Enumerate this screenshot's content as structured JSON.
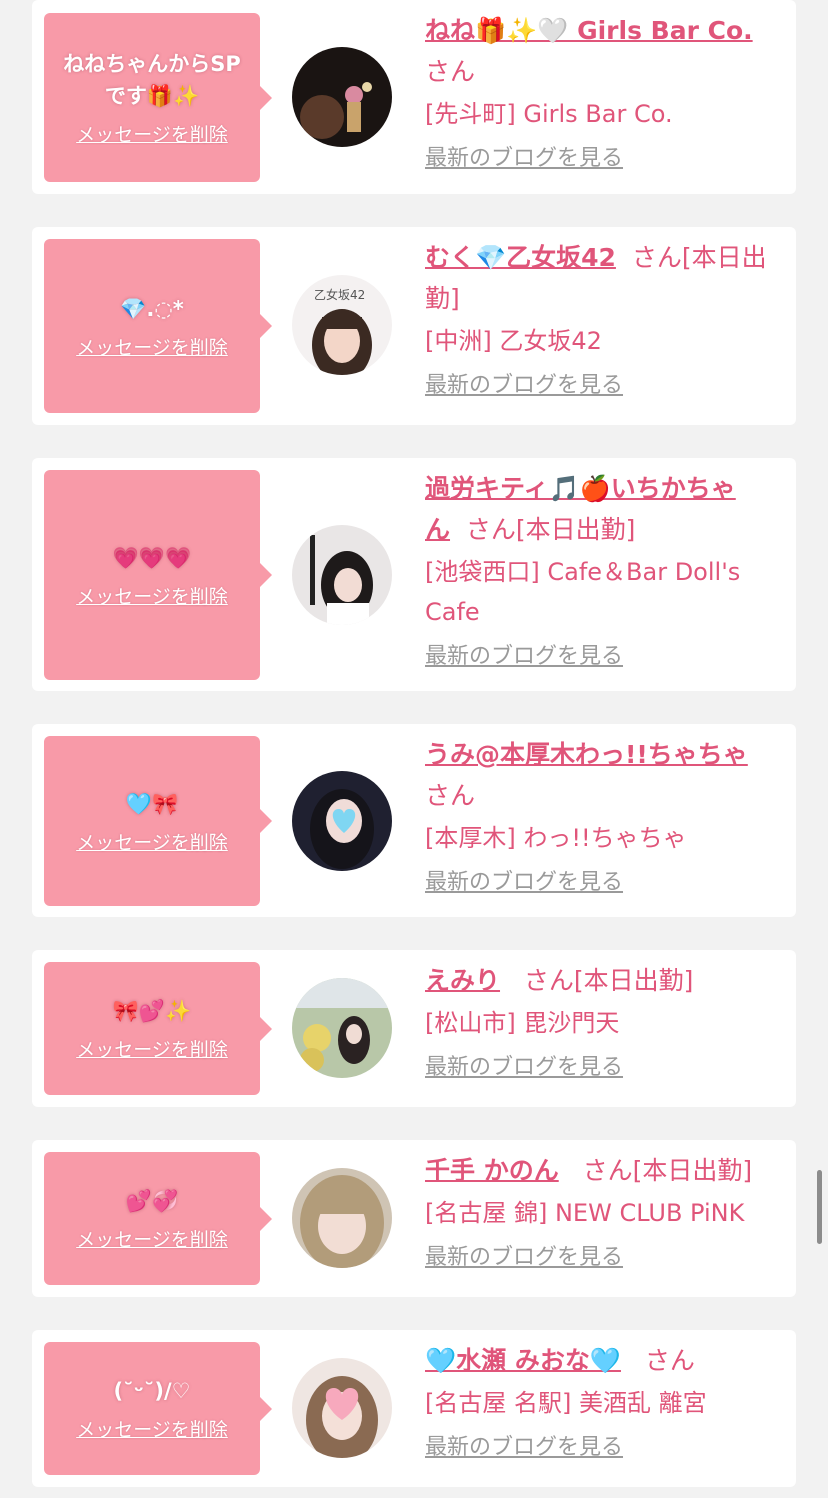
{
  "entries": [
    {
      "message": "ねねちゃんからSP\nです🎁✨",
      "delete_label": "メッセージを削除",
      "name": "ねね🎁✨🤍 Girls Bar Co.",
      "suffix": "さん",
      "shop": "[先斗町] Girls Bar Co.",
      "blog_label": "最新のブログを見る"
    },
    {
      "message": "💎.◌*",
      "delete_label": "メッセージを削除",
      "name": "むく💎乙女坂42",
      "suffix": "さん[本日出勤]",
      "shop": "[中洲] 乙女坂42",
      "blog_label": "最新のブログを見る"
    },
    {
      "message": "💗💗💗",
      "delete_label": "メッセージを削除",
      "name": "過労キティ🎵🍎いちかちゃん",
      "suffix": "さん[本日出勤]",
      "shop": "[池袋西口] Cafe＆Bar Doll's Cafe",
      "blog_label": "最新のブログを見る"
    },
    {
      "message": "🩵🎀",
      "delete_label": "メッセージを削除",
      "name": "うみ@本厚木わっ!!ちゃちゃ",
      "suffix": "さん",
      "shop": "[本厚木] わっ!!ちゃちゃ",
      "blog_label": "最新のブログを見る"
    },
    {
      "message": "🎀💕✨",
      "delete_label": "メッセージを削除",
      "name": "えみり",
      "suffix": "さん[本日出勤]",
      "shop": "[松山市] 毘沙門天",
      "blog_label": "最新のブログを見る"
    },
    {
      "message": "💕💞",
      "delete_label": "メッセージを削除",
      "name": "千手 かのん",
      "suffix": "さん[本日出勤]",
      "shop": "[名古屋 錦] NEW CLUB PiNK",
      "blog_label": "最新のブログを見る"
    },
    {
      "message": "(˘ᵕ˘)/♡",
      "delete_label": "メッセージを削除",
      "name": "🩵水瀬 みおな🩵",
      "suffix": "さん",
      "shop": "[名古屋 名駅] 美酒乱 離宮",
      "blog_label": "最新のブログを見る"
    }
  ],
  "colors": {
    "accent": "#e0557a",
    "bubble": "#f89aa8",
    "background": "#f2f2f2",
    "link_gray": "#9a9a9a"
  }
}
